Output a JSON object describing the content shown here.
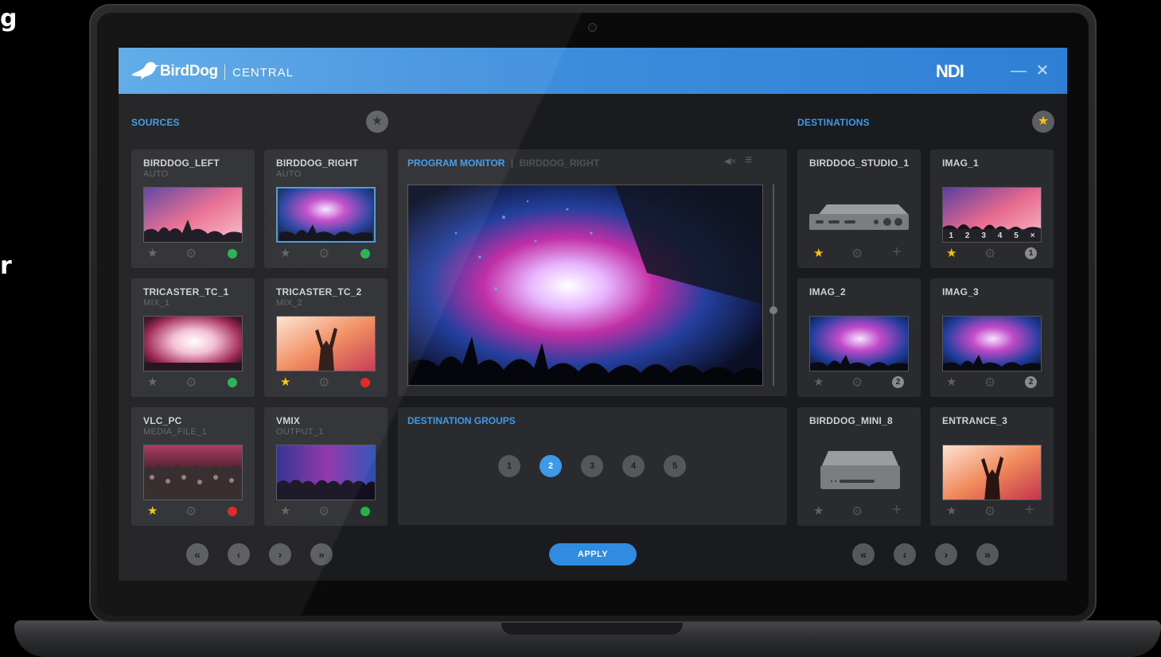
{
  "side_text": {
    "top": "g",
    "bottom": "r"
  },
  "app": {
    "brand": "BirdDog",
    "product": "CENTRAL",
    "ndi_logo": "NDI",
    "minimize_glyph": "—",
    "close_glyph": "✕"
  },
  "sources": {
    "label": "SOURCES",
    "cards": [
      {
        "name": "BIRDDOG_LEFT",
        "sub": "AUTO",
        "star": false,
        "status": "green",
        "status_color": "#22b14c",
        "image": "concert-pink"
      },
      {
        "name": "BIRDDOG_RIGHT",
        "sub": "AUTO",
        "star": false,
        "status": "green",
        "status_color": "#22b14c",
        "image": "concert-blue",
        "selected": true
      },
      {
        "name": "TRICASTER_TC_1",
        "sub": "MIX_1",
        "star": false,
        "status": "green",
        "status_color": "#22b14c",
        "image": "stage-lights"
      },
      {
        "name": "TRICASTER_TC_2",
        "sub": "MIX_2",
        "star": true,
        "status": "red",
        "status_color": "#e0201e",
        "image": "performer"
      },
      {
        "name": "VLC_PC",
        "sub": "MEDIA_FILE_1",
        "star": true,
        "status": "red",
        "status_color": "#e0201e",
        "image": "crowd"
      },
      {
        "name": "VMIX",
        "sub": "OUTPUT_1",
        "star": false,
        "status": "green",
        "status_color": "#22b14c",
        "image": "purple-stage"
      }
    ]
  },
  "program_monitor": {
    "label": "PROGRAM MONITOR",
    "separator": "|",
    "source": "BIRDDOG_RIGHT",
    "mute_glyph": "◀×",
    "menu_glyph": "≡"
  },
  "destination_groups": {
    "label": "DESTINATION GROUPS",
    "groups": [
      "1",
      "2",
      "3",
      "4",
      "5"
    ],
    "active": "2"
  },
  "destinations": {
    "label": "DESTINATIONS",
    "cards": [
      {
        "name": "BIRDDOG_STUDIO_1",
        "star": true,
        "action": "plus",
        "image": "device-studio"
      },
      {
        "name": "IMAG_1",
        "star": true,
        "action": "1",
        "image": "concert-pink",
        "overlay": [
          "1",
          "2",
          "3",
          "4",
          "5",
          "×"
        ]
      },
      {
        "name": "IMAG_2",
        "star": false,
        "action": "2",
        "image": "concert-blue"
      },
      {
        "name": "IMAG_3",
        "star": false,
        "action": "2",
        "image": "concert-blue"
      },
      {
        "name": "BIRDDOG_MINI_8",
        "star": false,
        "action": "plus",
        "image": "device-mini"
      },
      {
        "name": "ENTRANCE_3",
        "star": false,
        "action": "plus",
        "image": "performer"
      }
    ]
  },
  "pager": {
    "first": "«",
    "prev": "‹",
    "next": "›",
    "last": "»"
  },
  "apply_label": "APPLY",
  "icons": {
    "star": "star-icon",
    "gear": "gear-icon",
    "plus": "plus-icon",
    "status": "status-dot-icon"
  },
  "colors": {
    "accent": "#3d9ae8",
    "star_on": "#f5c400",
    "status_green": "#22b14c",
    "status_red": "#e0201e"
  }
}
